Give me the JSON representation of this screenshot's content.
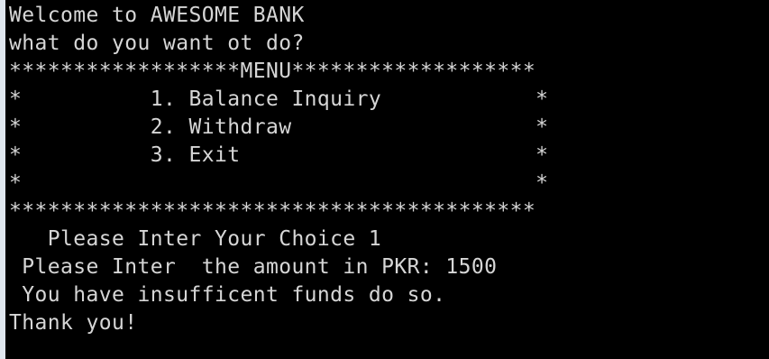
{
  "console": {
    "lines": [
      "Welcome to AWESOME BANK",
      "what do you want ot do?",
      "******************MENU*******************",
      "*          1. Balance Inquiry            *",
      "*          2. Withdraw                   *",
      "*          3. Exit                       *",
      "*                                        *",
      "*****************************************",
      "   Please Inter Your Choice 1",
      " Please Inter  the amount in PKR: 1500",
      " You have insufficent funds do so.",
      "Thank you!"
    ]
  },
  "colors": {
    "background": "#000000",
    "text": "#d6d6d6"
  }
}
